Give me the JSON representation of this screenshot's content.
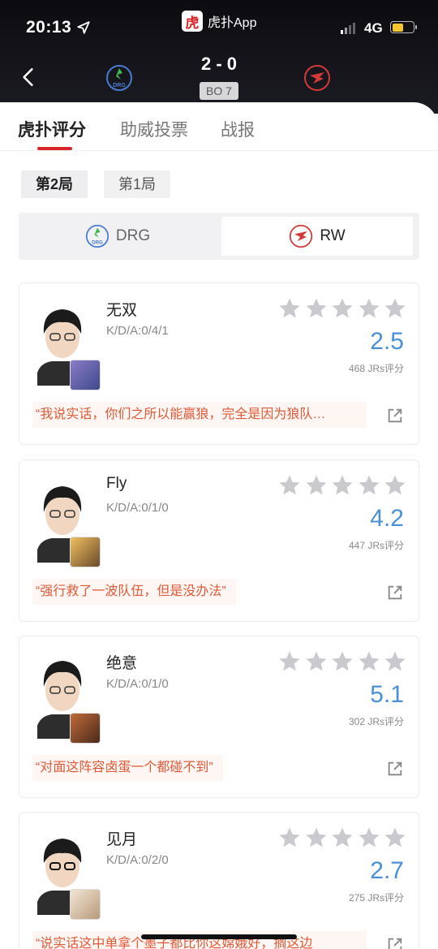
{
  "status_bar": {
    "time": "20:13",
    "network": "4G"
  },
  "app": {
    "logo_char": "虎",
    "name": "虎扑App"
  },
  "match": {
    "score": "2 - 0",
    "format": "BO 7",
    "team_left": "DRG",
    "team_right": "RW"
  },
  "tabs": [
    {
      "label": "虎扑评分",
      "active": true
    },
    {
      "label": "助威投票",
      "active": false
    },
    {
      "label": "战报",
      "active": false
    }
  ],
  "games": [
    {
      "label": "第2局",
      "active": true
    },
    {
      "label": "第1局",
      "active": false
    }
  ],
  "team_switch": {
    "drg": "DRG",
    "rw": "RW",
    "selected": "RW"
  },
  "players": [
    {
      "name": "无双",
      "kda": "K/D/A:0/4/1",
      "rating": "2.5",
      "votes": "468 JRs评分",
      "quote": "“我说实话，你们之所以能赢狼，完全是因为狼队…"
    },
    {
      "name": "Fly",
      "kda": "K/D/A:0/1/0",
      "rating": "4.2",
      "votes": "447 JRs评分",
      "quote": "“强行救了一波队伍，但是没办法”"
    },
    {
      "name": "绝意",
      "kda": "K/D/A:0/1/0",
      "rating": "5.1",
      "votes": "302 JRs评分",
      "quote": "“对面这阵容卤蛋一个都碰不到”"
    },
    {
      "name": "见月",
      "kda": "K/D/A:0/2/0",
      "rating": "2.7",
      "votes": "275 JRs评分",
      "quote": "“说实话这中单拿个墨子都比你这嫦娥好，搁这边"
    }
  ],
  "colors": {
    "accent_red": "#d6262b",
    "rating_blue": "#4a90d9",
    "quote_orange": "#e05a3a"
  }
}
